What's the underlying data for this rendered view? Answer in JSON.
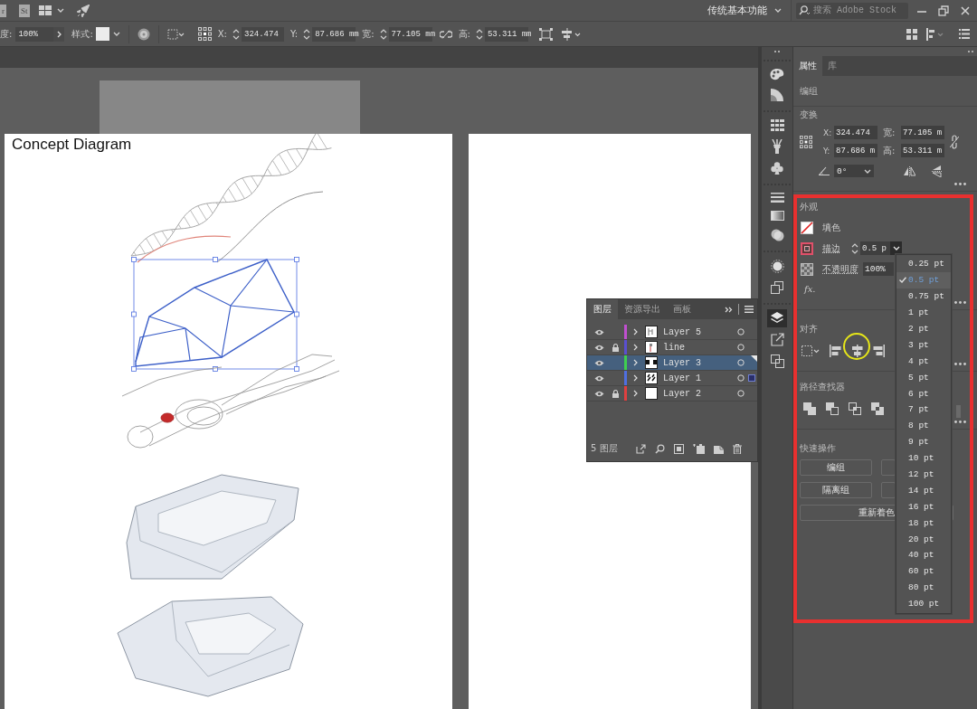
{
  "menu_bar": {
    "app_badges": [
      "r",
      "St"
    ],
    "workspace": "传统基本功能",
    "stock_search": {
      "placeholder": "搜索 Adobe Stock"
    }
  },
  "control_bar": {
    "opacity_label": "度:",
    "opacity": "100%",
    "style_label": "样式:",
    "fields": [
      {
        "label": "X:",
        "value": "324.474"
      },
      {
        "label": "Y:",
        "value": "87.686 mm"
      },
      {
        "label": "宽:",
        "value": "77.105 mm"
      },
      {
        "label": "高:",
        "value": "53.311 mm"
      }
    ]
  },
  "artboard": {
    "title": "Concept Diagram"
  },
  "layers_panel": {
    "tabs": [
      {
        "label": "图层",
        "selected": true
      },
      {
        "label": "资源导出",
        "selected": false
      },
      {
        "label": "画板",
        "selected": false
      }
    ],
    "layers": [
      {
        "name": "Layer 5",
        "color": "#c04fd0",
        "visible": true,
        "locked": false,
        "selected": false,
        "current": false,
        "has_selected_art": false
      },
      {
        "name": "line",
        "color": "#5a4fd0",
        "visible": true,
        "locked": true,
        "selected": false,
        "current": false,
        "has_selected_art": false
      },
      {
        "name": "Layer 3",
        "color": "#3fcf4f",
        "visible": true,
        "locked": false,
        "selected": true,
        "current": true,
        "has_selected_art": false
      },
      {
        "name": "Layer 1",
        "color": "#4f6fe0",
        "visible": true,
        "locked": false,
        "selected": false,
        "current": false,
        "has_selected_art": true
      },
      {
        "name": "Layer 2",
        "color": "#e04040",
        "visible": true,
        "locked": true,
        "selected": false,
        "current": false,
        "has_selected_art": false
      }
    ],
    "count": "5 图层"
  },
  "properties_panel": {
    "tabs": [
      {
        "label": "属性",
        "selected": true
      },
      {
        "label": "库",
        "selected": false
      }
    ],
    "object_type": "编组",
    "transform": {
      "heading": "变换",
      "fields": [
        {
          "label": "X:",
          "value": "324.474"
        },
        {
          "label": "宽:",
          "value": "77.105 m"
        },
        {
          "label": "Y:",
          "value": "87.686 m"
        },
        {
          "label": "高:",
          "value": "53.311 m"
        }
      ],
      "angle": "0°"
    },
    "appearance": {
      "heading": "外观",
      "fill_label": "填色",
      "stroke_label": "描边",
      "stroke_weight": "0.5 p",
      "opacity_label": "不透明度",
      "opacity": "100%",
      "effects_label": "fx."
    },
    "align": {
      "heading": "对齐"
    },
    "pathfinder": {
      "heading": "路径查找器"
    },
    "quick_actions": {
      "heading": "快速操作",
      "buttons": [
        {
          "label": "编组",
          "kind": "half"
        },
        {
          "label": "隔离组",
          "kind": "half"
        },
        {
          "label": "重新着色",
          "kind": "wide"
        }
      ]
    }
  },
  "stroke_weight_menu": [
    {
      "label": "0.25 pt",
      "selected": false
    },
    {
      "label": "0.5 pt",
      "selected": true
    },
    {
      "label": "0.75 pt",
      "selected": false
    },
    {
      "label": "1 pt",
      "selected": false
    },
    {
      "label": "2 pt",
      "selected": false
    },
    {
      "label": "3 pt",
      "selected": false
    },
    {
      "label": "4 pt",
      "selected": false
    },
    {
      "label": "5 pt",
      "selected": false
    },
    {
      "label": "6 pt",
      "selected": false
    },
    {
      "label": "7 pt",
      "selected": false
    },
    {
      "label": "8 pt",
      "selected": false
    },
    {
      "label": "9 pt",
      "selected": false
    },
    {
      "label": "10 pt",
      "selected": false
    },
    {
      "label": "12 pt",
      "selected": false
    },
    {
      "label": "14 pt",
      "selected": false
    },
    {
      "label": "16 pt",
      "selected": false
    },
    {
      "label": "18 pt",
      "selected": false
    },
    {
      "label": "20 pt",
      "selected": false
    },
    {
      "label": "40 pt",
      "selected": false
    },
    {
      "label": "60 pt",
      "selected": false
    },
    {
      "label": "80 pt",
      "selected": false
    },
    {
      "label": "100 pt",
      "selected": false
    }
  ]
}
